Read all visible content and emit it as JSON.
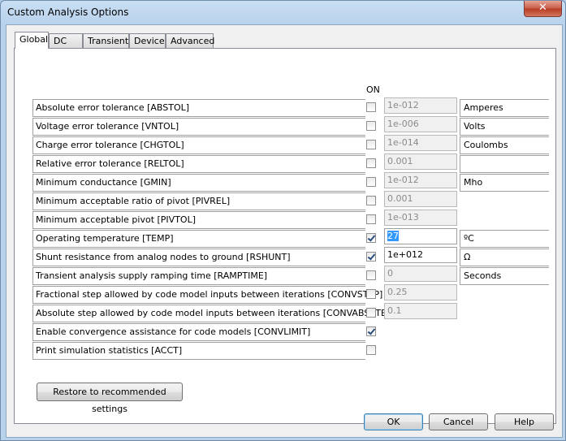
{
  "window": {
    "title": "Custom Analysis Options",
    "close_glyph": "✕"
  },
  "tabs": [
    "Global",
    "DC",
    "Transient",
    "Device",
    "Advanced"
  ],
  "on_header": "ON",
  "rows": [
    {
      "label": "Absolute error tolerance [ABSTOL]",
      "checked": false,
      "value": "1e-012",
      "unit": "Amperes"
    },
    {
      "label": "Voltage error tolerance [VNTOL]",
      "checked": false,
      "value": "1e-006",
      "unit": "Volts"
    },
    {
      "label": "Charge error tolerance [CHGTOL]",
      "checked": false,
      "value": "1e-014",
      "unit": "Coulombs"
    },
    {
      "label": "Relative error tolerance [RELTOL]",
      "checked": false,
      "value": "0.001",
      "unit": ""
    },
    {
      "label": "Minimum conductance [GMIN]",
      "checked": false,
      "value": "1e-012",
      "unit": "Mho"
    },
    {
      "label": "Minimum acceptable ratio of pivot [PIVREL]",
      "checked": false,
      "value": "0.001",
      "unit": ""
    },
    {
      "label": "Minimum acceptable pivot [PIVTOL]",
      "checked": false,
      "value": "1e-013",
      "unit": ""
    },
    {
      "label": "Operating temperature [TEMP]",
      "checked": true,
      "value": "27",
      "unit": "ºC"
    },
    {
      "label": "Shunt resistance from analog nodes to ground [RSHUNT]",
      "checked": true,
      "value": "1e+012",
      "unit": "Ω"
    },
    {
      "label": "Transient analysis supply ramping time [RAMPTIME]",
      "checked": false,
      "value": "0",
      "unit": "Seconds"
    },
    {
      "label": "Fractional step allowed by code model inputs between iterations [CONVSTEP]",
      "checked": false,
      "value": "0.25",
      "unit": ""
    },
    {
      "label": "Absolute step allowed by code model inputs between iterations [CONVABSSTEP]",
      "checked": false,
      "value": "0.1",
      "unit": ""
    },
    {
      "label": "Enable convergence assistance for code models [CONVLIMIT]",
      "checked": true,
      "value": "",
      "unit": ""
    },
    {
      "label": "Print simulation statistics [ACCT]",
      "checked": false,
      "value": "",
      "unit": ""
    }
  ],
  "buttons": {
    "restore": "Restore to recommended settings",
    "ok": "OK",
    "cancel": "Cancel",
    "help": "Help"
  }
}
